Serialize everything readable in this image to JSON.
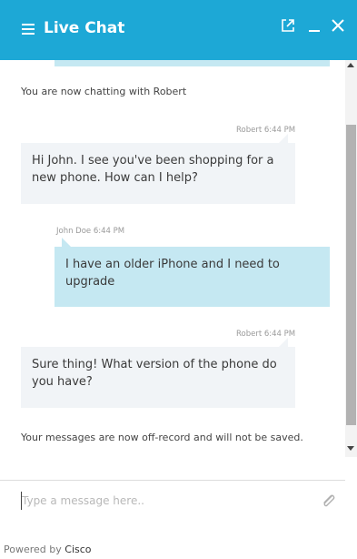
{
  "header": {
    "title": "Live Chat",
    "menu_icon": "hamburger-menu-icon",
    "popout_icon": "popout-icon",
    "minimize_icon": "minimize-icon",
    "close_icon": "close-icon",
    "background_color": "#1da8d6"
  },
  "chat": {
    "system_message_1": "You are now chatting with Robert",
    "messages": [
      {
        "sender": "Robert",
        "time": "6:44 PM",
        "meta": "Robert 6:44 PM",
        "text": "Hi John. I see you've been shopping for a new phone. How can I help?",
        "role": "agent"
      },
      {
        "sender": "John Doe",
        "time": "6:44 PM",
        "meta": "John Doe 6:44 PM",
        "text": "I have an older iPhone and I need to upgrade",
        "role": "user"
      },
      {
        "sender": "Robert",
        "time": "6:44 PM",
        "meta": "Robert 6:44 PM",
        "text": "Sure thing! What version of the phone do you have?",
        "role": "agent"
      }
    ],
    "system_message_2": "Your messages are now off-record and will not be saved."
  },
  "composer": {
    "placeholder": "Type a message here..",
    "attach_icon": "paperclip-icon"
  },
  "footer": {
    "powered_prefix": "Powered by",
    "brand": "Cisco"
  },
  "colors": {
    "agent_bubble": "#f1f4f7",
    "user_bubble": "#c5e8f2"
  }
}
